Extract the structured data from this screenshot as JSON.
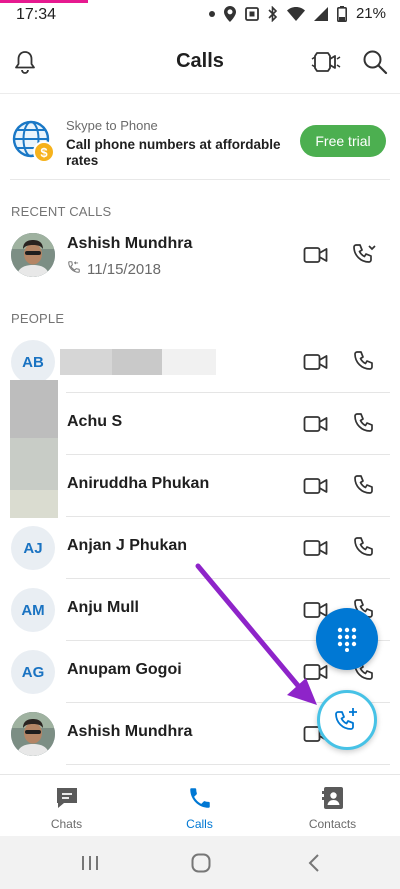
{
  "status_bar": {
    "time": "17:34",
    "battery_percent": "21%",
    "icons": [
      "dot-icon",
      "location-icon",
      "nfc-icon",
      "bluetooth-icon",
      "wifi-icon",
      "signal-icon",
      "battery-icon"
    ]
  },
  "header": {
    "title": "Calls",
    "left_icon": "bell-icon",
    "right_icons": [
      "video-call-icon",
      "search-icon"
    ]
  },
  "promo": {
    "kicker": "Skype to Phone",
    "description": "Call phone numbers at affordable rates",
    "button_label": "Free trial",
    "button_color": "#4caf50"
  },
  "recent_calls": {
    "heading": "RECENT CALLS",
    "items": [
      {
        "name": "Ashish Mundhra",
        "date": "11/15/2018"
      }
    ]
  },
  "people": {
    "heading": "PEOPLE",
    "items": [
      {
        "initials": "AB",
        "name": ""
      },
      {
        "initials": "",
        "name": "Achu S"
      },
      {
        "initials": "",
        "name": "Aniruddha Phukan"
      },
      {
        "initials": "AJ",
        "name": "Anjan J Phukan"
      },
      {
        "initials": "AM",
        "name": "Anju Mull"
      },
      {
        "initials": "AG",
        "name": "Anupam Gogoi"
      },
      {
        "initials": "",
        "name": "Ashish Mundhra"
      }
    ]
  },
  "fabs": {
    "dialpad_icon": "dialpad-icon",
    "new_call_icon": "add-call-icon",
    "accent": "#0078d4"
  },
  "annotation": {
    "arrow_color": "#8e24c9"
  },
  "bottom_nav": {
    "tabs": [
      {
        "label": "Chats",
        "icon": "chat-icon"
      },
      {
        "label": "Calls",
        "icon": "phone-icon",
        "active": true
      },
      {
        "label": "Contacts",
        "icon": "contacts-icon"
      }
    ]
  },
  "system_nav": {
    "buttons": [
      "recents-icon",
      "home-icon",
      "back-icon"
    ]
  }
}
